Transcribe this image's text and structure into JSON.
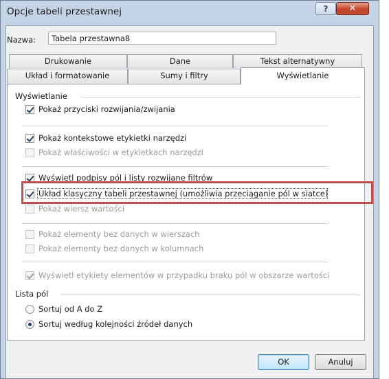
{
  "window": {
    "title": "Opcje tabeli przestawnej",
    "help_glyph": "?",
    "close_glyph": "✕"
  },
  "name_field": {
    "label": "Nazwa:",
    "value": "Tabela przestawna8"
  },
  "tabs_back": [
    {
      "label": "Drukowanie"
    },
    {
      "label": "Dane"
    },
    {
      "label": "Tekst alternatywny"
    }
  ],
  "tabs_front": [
    {
      "label": "Układ i formatowanie"
    },
    {
      "label": "Sumy i filtry"
    },
    {
      "label": "Wyświetlanie"
    }
  ],
  "display_group": {
    "label": "Wyświetlanie",
    "options": [
      {
        "label": "Pokaż przyciski rozwijania/zwijania",
        "checked": true,
        "disabled": false
      },
      {
        "label": "Pokaż kontekstowe etykietki narzędzi",
        "checked": true,
        "disabled": false
      },
      {
        "label": "Pokaż właściwości w etykietkach narzędzi",
        "checked": false,
        "disabled": true
      },
      {
        "label": "Wyświetl podpisy pól i listy rozwijane filtrów",
        "checked": true,
        "disabled": false
      },
      {
        "label": "Układ klasyczny tabeli przestawnej (umożliwia przeciąganie pól w siatce)",
        "checked": true,
        "disabled": false
      },
      {
        "label": "Pokaż wiersz wartości",
        "checked": false,
        "disabled": true
      },
      {
        "label": "Pokaż elementy bez danych w wierszach",
        "checked": false,
        "disabled": true
      },
      {
        "label": "Pokaż elementy bez danych w kolumnach",
        "checked": false,
        "disabled": true
      },
      {
        "label": "Wyświetl etykiety elementów w przypadku braku pól w obszarze wartości",
        "checked": true,
        "disabled": true
      }
    ]
  },
  "field_list_group": {
    "label": "Lista pól",
    "options": [
      {
        "label": "Sortuj od A do Z",
        "selected": false
      },
      {
        "label": "Sortuj według kolejności źródeł danych",
        "selected": true
      }
    ]
  },
  "buttons": {
    "ok": "OK",
    "cancel": "Anuluj"
  },
  "colors": {
    "highlight": "#c0504d",
    "close_button": "#c5442c",
    "title_bar": "#c4d3e6"
  }
}
